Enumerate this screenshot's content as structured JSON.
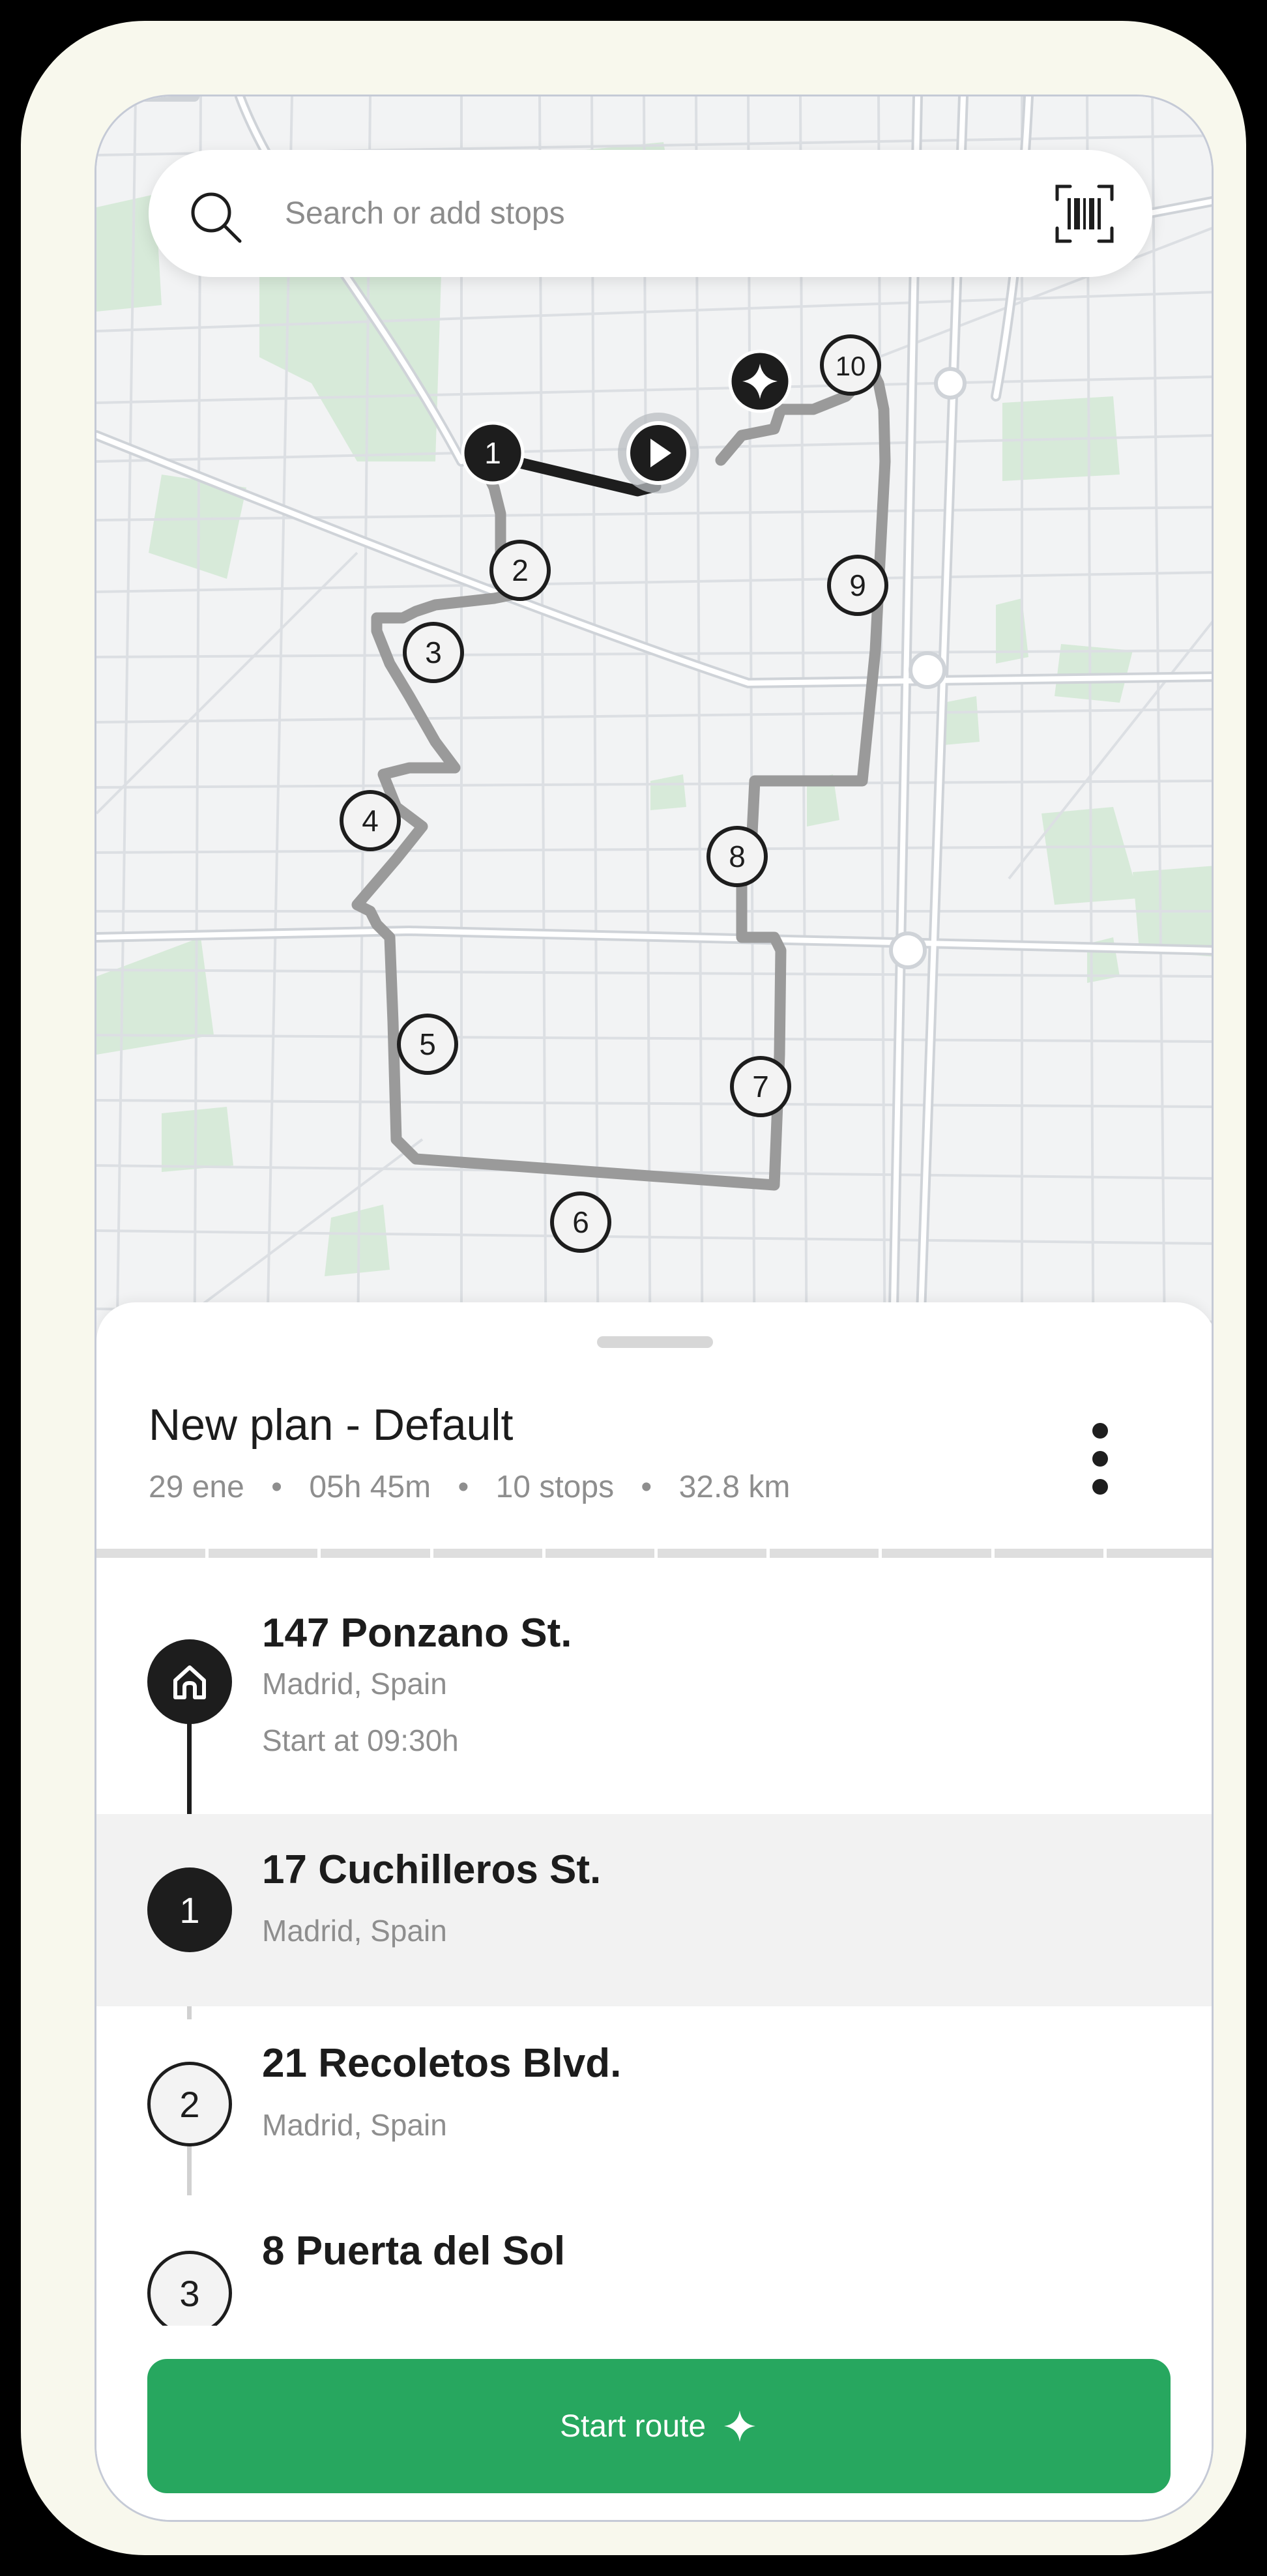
{
  "search": {
    "placeholder": "Search or add stops"
  },
  "icons": {
    "search": "search-icon",
    "barcode": "barcode-scan-icon",
    "more": "more-vertical-icon",
    "home": "home-icon",
    "sparkle": "sparkle-icon",
    "play": "play-icon"
  },
  "map": {
    "stop_labels": [
      "1",
      "2",
      "3",
      "4",
      "5",
      "6",
      "7",
      "8",
      "9",
      "10"
    ]
  },
  "plan": {
    "title": "New plan - Default",
    "date": "29 ene",
    "duration": "05h 45m",
    "stops_count": "10 stops",
    "distance": "32.8 km",
    "separator": "•"
  },
  "stops": [
    {
      "marker": "home-icon",
      "name": "147 Ponzano St.",
      "city": "Madrid, Spain",
      "start": "Start at 09:30h"
    },
    {
      "marker": "1",
      "name": "17 Cuchilleros St.",
      "city": "Madrid, Spain"
    },
    {
      "marker": "2",
      "name": "21 Recoletos Blvd.",
      "city": "Madrid, Spain"
    },
    {
      "marker": "3",
      "name": "8 Puerta del Sol"
    }
  ],
  "cta": {
    "label": "Start route"
  },
  "colors": {
    "accent": "#27a75f",
    "route_done": "#1d1d1d",
    "route_pending": "#9a9a9a",
    "park": "#d7ead9",
    "map_bg": "#f2f3f4",
    "frame": "#f8f8ed"
  }
}
